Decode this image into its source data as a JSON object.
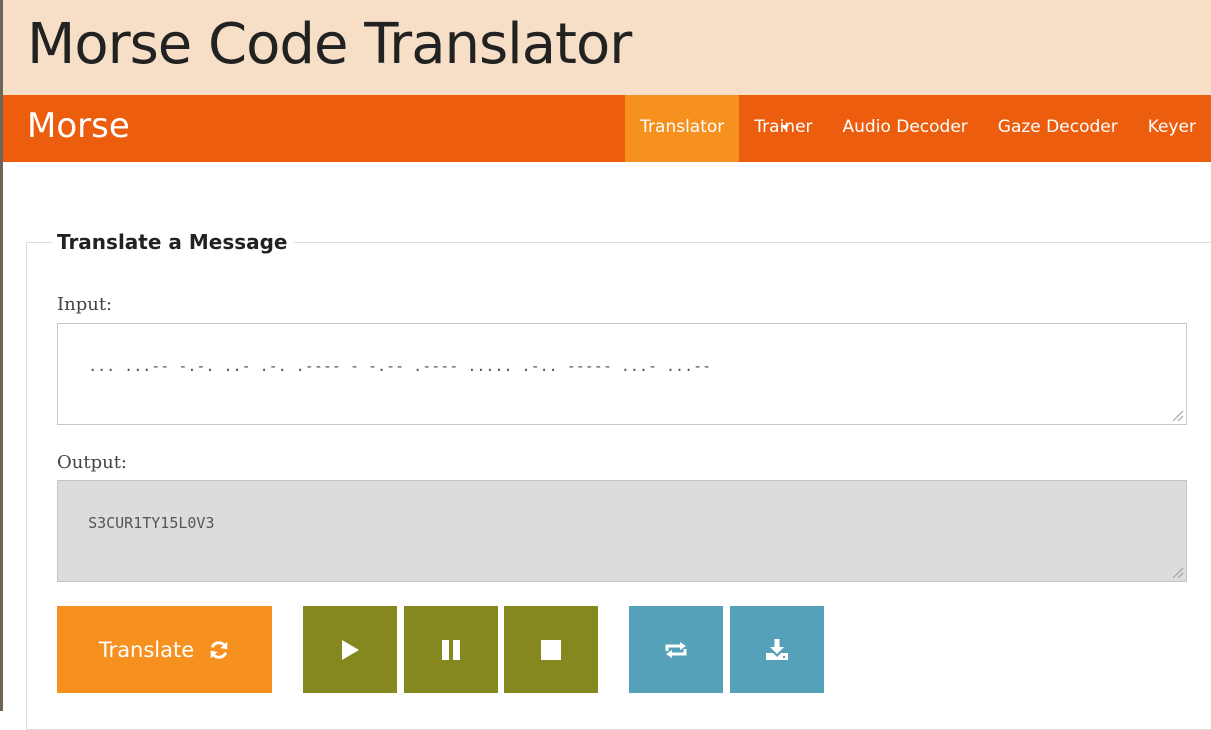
{
  "page": {
    "title": "Morse Code Translator"
  },
  "navbar": {
    "brand": "Morse",
    "items": [
      {
        "label": "Translator",
        "active": true
      },
      {
        "label": "Trainer",
        "has_dropdown": true
      },
      {
        "label": "Audio Decoder"
      },
      {
        "label": "Gaze Decoder"
      },
      {
        "label": "Keyer"
      }
    ]
  },
  "panel": {
    "title": "Translate a Message",
    "input": {
      "label": "Input:",
      "value": "... ...-- -.-. ..- .-. .---- - -.-- .---- ..... .-.. ----- ...- ...--"
    },
    "output": {
      "label": "Output:",
      "value": "S3CUR1TY15L0V3"
    }
  },
  "buttons": {
    "translate_label": "Translate",
    "translate_icon": "refresh-icon",
    "playback": [
      "play-icon",
      "pause-icon",
      "stop-icon"
    ],
    "extras": [
      "repeat-icon",
      "download-icon"
    ]
  },
  "colors": {
    "title_bar": "#f6dfc6",
    "navbar": "#ec5e0e",
    "nav_active": "#f6901f",
    "translate_button": "#f6901f",
    "playback_buttons": "#85881e",
    "extra_buttons": "#56a1ba",
    "output_background": "#dcdcdc"
  }
}
